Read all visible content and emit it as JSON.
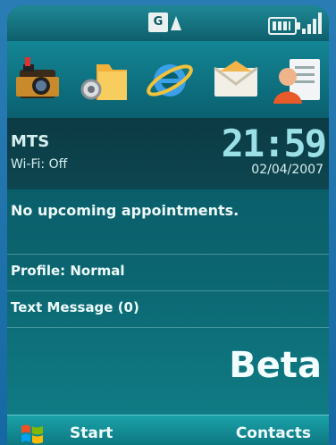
{
  "status": {
    "gprs_label": "G",
    "icons": [
      "gprs-icon",
      "battery-icon",
      "signal-strength-icon"
    ]
  },
  "shortcuts": [
    {
      "name": "camera-icon"
    },
    {
      "name": "settings-folder-icon"
    },
    {
      "name": "internet-explorer-icon"
    },
    {
      "name": "email-icon"
    },
    {
      "name": "contacts-card-icon"
    }
  ],
  "today": {
    "carrier": "MTS",
    "wifi": "Wi-Fi: Off",
    "time": "21:59",
    "date": "02/04/2007",
    "appointments": "No upcoming appointments.",
    "profile": "Profile: Normal",
    "messages": "Text Message (0)",
    "watermark": "Beta"
  },
  "softkeys": {
    "left": "Start",
    "right": "Contacts"
  },
  "colors": {
    "background": "#0b6570",
    "accent": "#9be0e6",
    "text": "#eefafa"
  }
}
